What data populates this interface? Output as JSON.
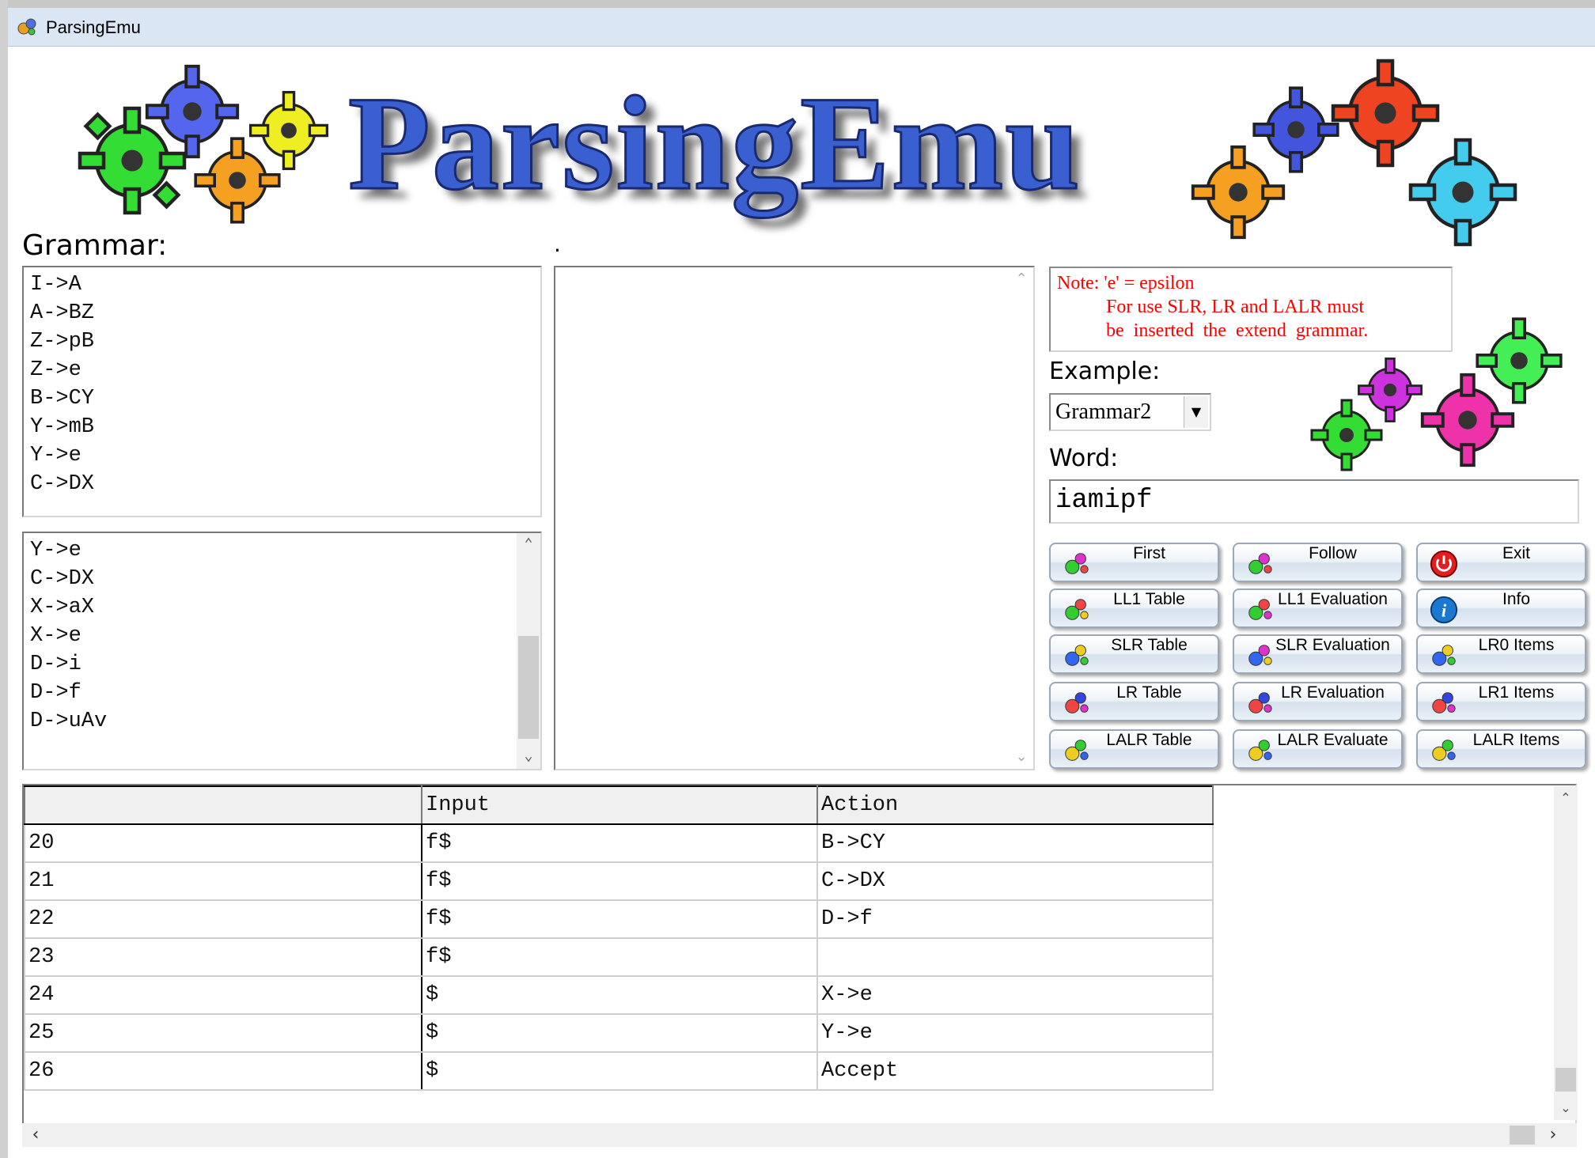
{
  "window": {
    "title": "ParsingEmu"
  },
  "banner": {
    "title": "ParsingEmu"
  },
  "grammar": {
    "label": "Grammar:",
    "rules": [
      "I->A",
      "A->BZ",
      "Z->pB",
      "Z->e",
      "B->CY",
      "Y->mB",
      "Y->e",
      "C->DX"
    ],
    "rules_more": [
      "Y->e",
      "C->DX",
      "X->aX",
      "X->e",
      "D->i",
      "D->f",
      "D->uAv"
    ]
  },
  "middle": {
    "label": "."
  },
  "note": {
    "line1": "Note: 'e' = epsilon",
    "line2": "For use SLR,  LR  and LALR  must",
    "line3": "be  inserted  the  extend  grammar."
  },
  "example": {
    "label": "Example:",
    "selected": "Grammar2"
  },
  "word": {
    "label": "Word:",
    "value": "iamipf"
  },
  "buttons": [
    [
      "First",
      "Follow",
      "Exit"
    ],
    [
      "LL1 Table",
      "LL1 Evaluation",
      "Info"
    ],
    [
      "SLR Table",
      "SLR Evaluation",
      "LR0 Items"
    ],
    [
      "LR Table",
      "LR Evaluation",
      "LR1 Items"
    ],
    [
      "LALR Table",
      "LALR Evaluate",
      "LALR Items"
    ]
  ],
  "table": {
    "headers": [
      "",
      "Input",
      "Action"
    ],
    "rows": [
      [
        "20",
        "f$",
        "B->CY"
      ],
      [
        "21",
        "f$",
        "C->DX"
      ],
      [
        "22",
        "f$",
        "D->f"
      ],
      [
        "23",
        "f$",
        ""
      ],
      [
        "24",
        "$",
        "X->e"
      ],
      [
        "25",
        "$",
        "Y->e"
      ],
      [
        "26",
        "$",
        "Accept"
      ]
    ]
  },
  "colors": {
    "note_text": "#ff0000",
    "title_blue": "#3a5fd0",
    "titlebar": "#dbe6f4"
  },
  "icons": {
    "app": "gears-icon",
    "exit": "power-icon",
    "info": "info-icon",
    "default_button": "gears-icon"
  }
}
